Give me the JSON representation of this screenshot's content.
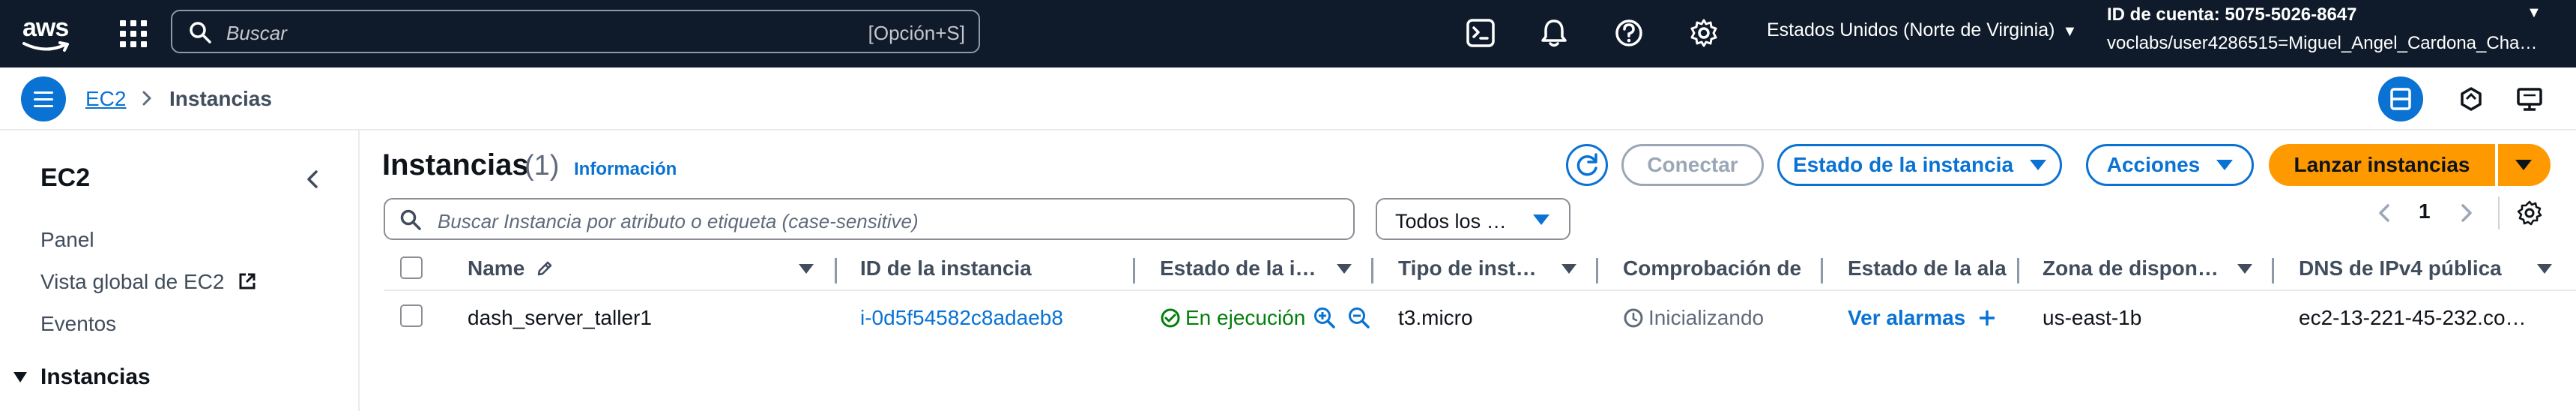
{
  "topnav": {
    "logo_text": "aws",
    "search_placeholder": "Buscar",
    "search_shortcut": "[Opción+S]",
    "region_label": "Estados Unidos (Norte de Virginia)",
    "account_id": "ID de cuenta: 5075-5026-8647",
    "account_user": "voclabs/user4286515=Miguel_Angel_Cardona_Cha…"
  },
  "breadcrumb": {
    "root": "EC2",
    "current": "Instancias"
  },
  "sidebar": {
    "title": "EC2",
    "items": [
      "Panel",
      "Vista global de EC2",
      "Eventos"
    ],
    "section": "Instancias"
  },
  "main": {
    "title": "Instancias",
    "count": "(1)",
    "info_link": "Información",
    "buttons": {
      "connect": "Conectar",
      "instance_state": "Estado de la instancia",
      "actions": "Acciones",
      "launch": "Lanzar instancias"
    },
    "filter_placeholder": "Buscar Instancia por atributo o etiqueta (case-sensitive)",
    "filter_select": "Todos los …",
    "page_number": "1",
    "columns": [
      "Name",
      "ID de la instancia",
      "Estado de la i…",
      "Tipo de inst…",
      "Comprobación de",
      "Estado de la ala",
      "Zona de dispon…",
      "DNS de IPv4 pública"
    ],
    "rows": [
      {
        "name": "dash_server_taller1",
        "id": "i-0d5f54582c8adaeb8",
        "state": "En ejecución",
        "type": "t3.micro",
        "check": "Inicializando",
        "alarm": "Ver alarmas",
        "zone": "us-east-1b",
        "dns": "ec2-13-221-45-232.co…"
      }
    ]
  },
  "colors": {
    "nav_bg": "#0f1b2a",
    "link": "#0972d3",
    "primary": "#ff9900",
    "success": "#037f0c"
  }
}
